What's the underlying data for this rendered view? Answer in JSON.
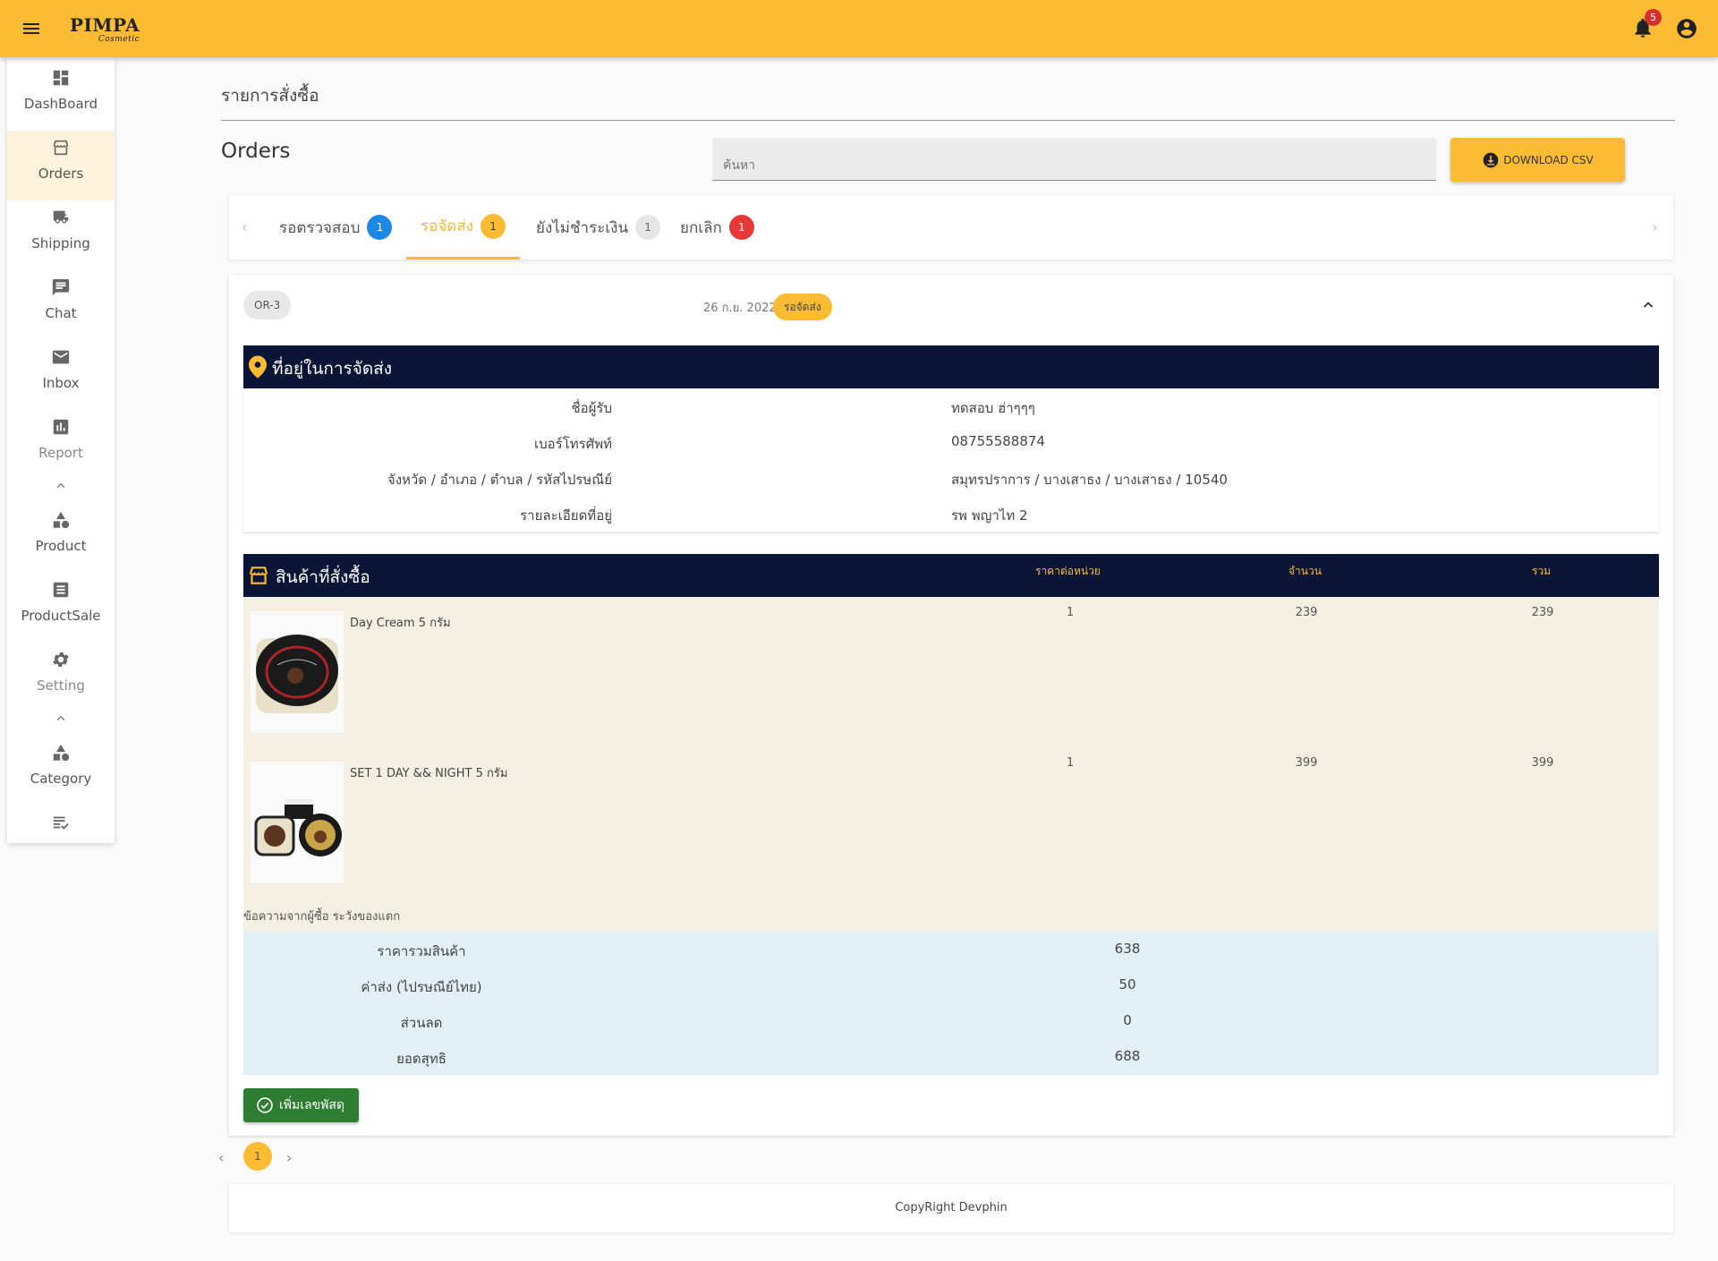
{
  "app": {
    "logo": "PIMPA",
    "logo_sub": "Cosmetic",
    "notifications_count": "5"
  },
  "sidebar": {
    "items": [
      {
        "label": "DashBoard",
        "icon": "dashboard-icon"
      },
      {
        "label": "Orders",
        "icon": "store-icon",
        "active": true
      },
      {
        "label": "Shipping",
        "icon": "truck-icon"
      },
      {
        "label": "Chat",
        "icon": "chat-icon"
      },
      {
        "label": "Inbox",
        "icon": "mail-icon"
      },
      {
        "label": "Report",
        "icon": "chart-icon"
      },
      {
        "label": "Product",
        "icon": "shapes-icon"
      },
      {
        "label": "ProductSale",
        "icon": "list-icon"
      },
      {
        "label": "Setting",
        "icon": "gear-icon"
      },
      {
        "label": "Category",
        "icon": "shapes-icon"
      }
    ]
  },
  "page": {
    "breadcrumb": "รายการสั่งซื้อ",
    "title": "Orders",
    "search_placeholder": "ค้นหา",
    "download_label": "DOWNLOAD CSV"
  },
  "tabs": [
    {
      "label": "รอตรวจสอบ",
      "count": "1",
      "color": "#1e88e5"
    },
    {
      "label": "รอจัดส่ง",
      "count": "1",
      "color": "#fbbc33",
      "active": true
    },
    {
      "label": "ยังไม่ชำระเงิน",
      "count": "1",
      "color": "#e0e0e0"
    },
    {
      "label": "ยกเลิก",
      "count": "1",
      "color": "#e53935"
    }
  ],
  "order": {
    "id": "OR-3",
    "date": "26 ก.ย. 2022",
    "status": "รอจัดส่ง",
    "address_title": "ที่อยู่ในการจัดส่ง",
    "address": [
      {
        "label": "ชื่อผู้รับ",
        "value": "ทดสอบ ฮ่าๆๆๆ"
      },
      {
        "label": "เบอร์โทรศัพท์",
        "value": "08755588874"
      },
      {
        "label": "จังหวัด / อำเภอ / ตำบล / รหัสไปรษณีย์",
        "value": "สมุทรปราการ / บางเสาธง / บางเสาธง / 10540"
      },
      {
        "label": "รายละเอียดที่อยู่",
        "value": "รพ พญาไท 2"
      }
    ],
    "products_title": "สินค้าที่สั่งซื้อ",
    "product_columns": {
      "unit_price": "ราคาต่อหน่วย",
      "qty": "จำนวน",
      "total": "รวม"
    },
    "products": [
      {
        "name": "Day Cream 5 กรัม",
        "unit_price": "1",
        "qty": "239",
        "total": "239"
      },
      {
        "name": "SET 1 DAY && NIGHT 5 กรัม",
        "unit_price": "1",
        "qty": "399",
        "total": "399"
      }
    ],
    "buyer_note": "ข้อความจากผู้ซื้อ ระวังของแตก",
    "totals": [
      {
        "label": "ราคารวมสินค้า",
        "value": "638"
      },
      {
        "label": "ค่าส่ง (ไปรษณีย์ไทย)",
        "value": "50"
      },
      {
        "label": "ส่วนลด",
        "value": "0"
      },
      {
        "label": "ยอดสุทธิ",
        "value": "688"
      }
    ],
    "add_parcel_label": "เพิ่มเลขพัสดุ"
  },
  "pagination": {
    "current": "1"
  },
  "footer": {
    "text": "CopyRight Devphin"
  },
  "colors": {
    "accent": "#fbbc33",
    "header_dark": "#0b1535",
    "success": "#2e7d32"
  }
}
